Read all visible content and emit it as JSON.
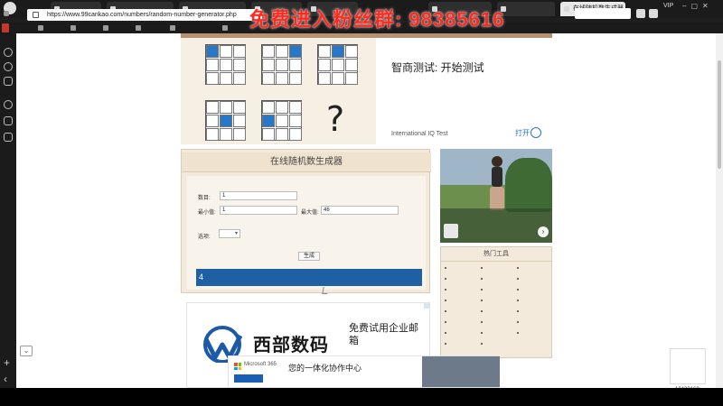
{
  "browser": {
    "tabs": [
      {
        "label": "",
        "active": false
      },
      {
        "label": "",
        "active": false
      },
      {
        "label": "",
        "active": false
      },
      {
        "label": "",
        "active": false
      },
      {
        "label": "",
        "active": false
      },
      {
        "label": "",
        "active": false
      },
      {
        "label": "",
        "active": false
      },
      {
        "label": "在线随机数生成器",
        "active": true
      }
    ],
    "url": "https://www.99cankao.com/numbers/random-number-generator.php",
    "search_placeholder": "",
    "vip_label": "VIP",
    "bookmarks": [
      "",
      "",
      "",
      "",
      "",
      ""
    ],
    "brand_badge": ""
  },
  "iq_ad": {
    "title": "智商测试: 开始测试",
    "description": "",
    "source": "International IQ Test",
    "open_label": "打开"
  },
  "generator": {
    "title": "在线随机数生成器",
    "instruction": "",
    "count_label": "数目:",
    "count_value": "1",
    "min_label": "最小值:",
    "min_value": "1",
    "max_label": "最大值:",
    "max_value": "46",
    "unique_label": "",
    "option_label": "选项:",
    "option_value": "",
    "click_label": "",
    "button_label": "生成",
    "result_label": "",
    "result_value": "4"
  },
  "west_ad": {
    "name": "西部数码",
    "slogan": "免费试用企业邮箱"
  },
  "photo_ad": {
    "title": "",
    "subtitle": ""
  },
  "tools": {
    "title": "热门工具",
    "items": [
      "",
      "",
      "",
      "",
      "",
      "",
      "",
      "",
      "",
      "",
      "",
      "",
      "",
      "",
      "",
      "",
      "",
      "",
      "",
      "",
      "",
      "",
      ""
    ]
  },
  "bottom_ad": {
    "brand": "Microsoft 365",
    "button": "",
    "title": "您的一体化协作中心",
    "subtitle": ""
  },
  "float_value": "10423168",
  "overlay": {
    "banner": "免费进入粉丝群: 98385616",
    "ticker_left": "",
    "ticker_right": ""
  },
  "colors": {
    "accent_blue": "#2878c8",
    "result_blue": "#1f5fa3",
    "overlay_red": "#ff2a1e",
    "panel_beige": "#f3eadb"
  }
}
